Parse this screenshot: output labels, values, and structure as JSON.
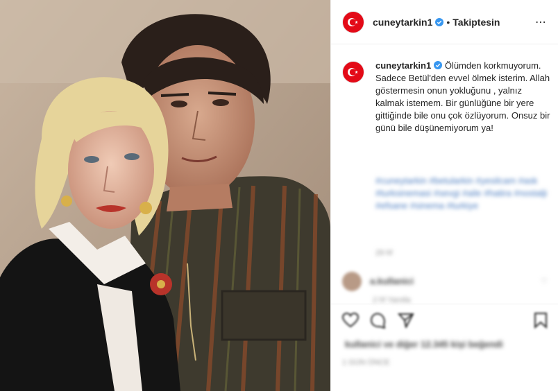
{
  "post": {
    "username": "cuneytarkin1",
    "verified": true,
    "separator": "•",
    "follow_status": "Takiptesin",
    "more_label": "⋯",
    "caption": "Ölümden korkmuyorum.\nSadece Betül'den evvel ölmek isterim. Allah göstermesin onun yokluğunu , yalnız kalmak istemem. Bir günlüğüne bir yere gittiğinde bile onu çok özlüyorum. Onsuz bir günü bile düşünemiyorum ya!",
    "hashtags_blurred": "#cuneytarkin #betularkin #yesilcam #ask #turksinemasi #sevgi #aile #hatira #nostalji #efsane #sinema #turkiye",
    "time_blurred": "29 hf",
    "comment_user_blurred": "a.kullanici",
    "comment_time_blurred": "2 hf  Yanıtla",
    "likes_blurred": "kullanici ve diğer 12.345 kişi beğendi",
    "date_blurred": "1 GÜN ÖNCE"
  },
  "colors": {
    "flag_red": "#e30a17",
    "text": "#262626",
    "link": "#00376b",
    "border": "#efefef",
    "verified_blue": "#3897f0"
  },
  "icons": [
    "turkish-flag-icon",
    "verified-icon",
    "more-icon",
    "heart-icon",
    "comment-icon",
    "share-icon",
    "save-icon"
  ]
}
